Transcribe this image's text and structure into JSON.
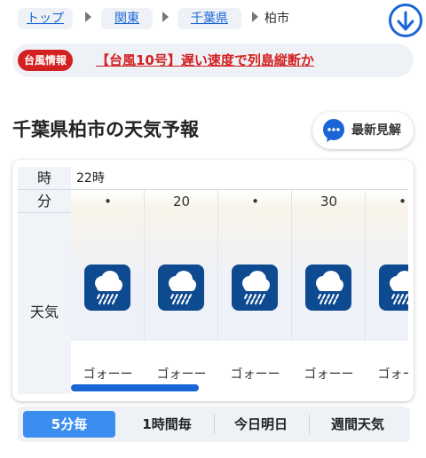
{
  "breadcrumb": {
    "items": [
      {
        "label": "トップ"
      },
      {
        "label": "関東"
      },
      {
        "label": "千葉県"
      }
    ],
    "current": "柏市"
  },
  "banner": {
    "badge": "台風情報",
    "headline": "【台風10号】遅い速度で列島縦断か"
  },
  "heading": {
    "title": "千葉県柏市の天気予報",
    "latest_button": "最新見解"
  },
  "forecast": {
    "labels": {
      "hour": "時",
      "minute": "分",
      "weather": "天気"
    },
    "hour": "22時",
    "columns": [
      {
        "minute": "•",
        "icon": "heavy-rain-icon",
        "text": "ゴォーー"
      },
      {
        "minute": "20",
        "icon": "heavy-rain-icon",
        "text": "ゴォーー"
      },
      {
        "minute": "•",
        "icon": "heavy-rain-icon",
        "text": "ゴォーー"
      },
      {
        "minute": "30",
        "icon": "heavy-rain-icon",
        "text": "ゴォーー"
      },
      {
        "minute": "•",
        "icon": "heavy-rain-icon",
        "text": "ゴォーー"
      }
    ]
  },
  "tabs": [
    {
      "label": "5分毎",
      "active": true
    },
    {
      "label": "1時間毎",
      "active": false
    },
    {
      "label": "今日明日",
      "active": false
    },
    {
      "label": "週間天気",
      "active": false
    }
  ],
  "colors": {
    "accent": "#1a66d6",
    "alert": "#d32020",
    "icon_bg": "#0e4a8f",
    "active_tab": "#3b8ef0"
  }
}
